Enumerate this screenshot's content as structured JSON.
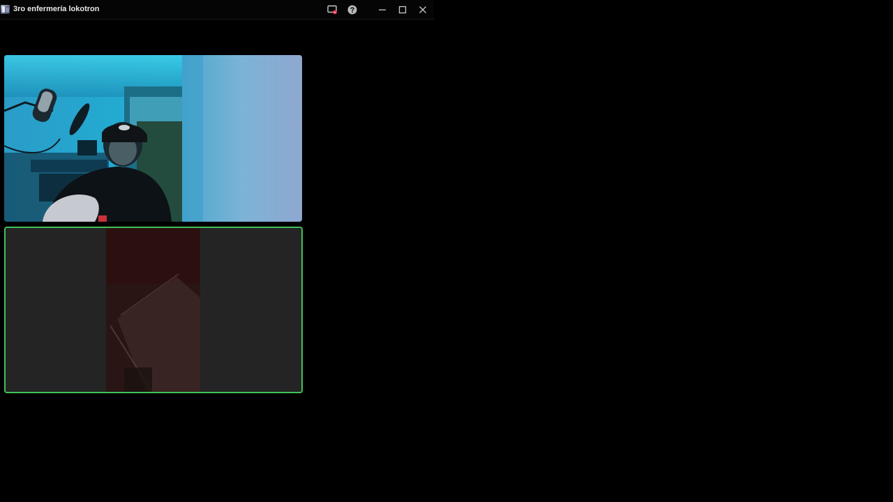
{
  "window": {
    "title": "3ro enfermería lokotron",
    "app_icon": "server-avatar-icon",
    "controls": [
      "screen-share-stop-icon",
      "help-icon",
      "minimize-icon",
      "maximize-icon",
      "close-icon"
    ]
  },
  "colors": {
    "background": "#000000",
    "speaking_border": "#41c25a",
    "screen_share_badge": "#e0334a"
  },
  "participants": [
    {
      "tile": "camera-video",
      "muted": true,
      "mute_icon": "microphone-muted-icon"
    },
    {
      "tile": "screen-share",
      "speaking": true
    }
  ]
}
